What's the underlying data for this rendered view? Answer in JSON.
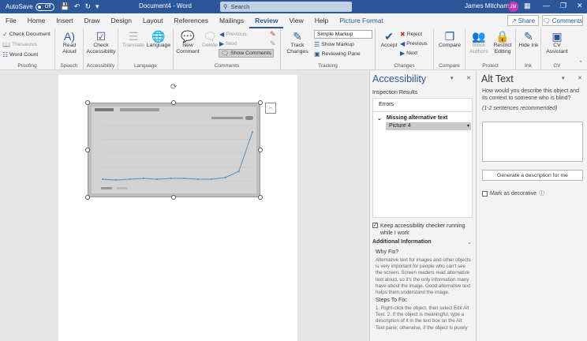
{
  "titlebar": {
    "autosave_label": "AutoSave",
    "autosave_state": "Off",
    "doc_title": "Document4 - Word",
    "search_placeholder": "Search",
    "user_name": "James Mitcham",
    "user_initials": "JM"
  },
  "tabs": [
    "File",
    "Home",
    "Insert",
    "Draw",
    "Design",
    "Layout",
    "References",
    "Mailings",
    "Review",
    "View",
    "Help",
    "Picture Format"
  ],
  "active_tab": "Review",
  "share_label": "Share",
  "comments_label": "Comments",
  "ribbon": {
    "proofing": {
      "label": "Proofing",
      "check_document": "Check Document",
      "thesaurus": "Thesaurus",
      "word_count": "Word Count"
    },
    "speech": {
      "label": "Speech",
      "read_aloud": "Read Aloud"
    },
    "accessibility": {
      "label": "Accessibility",
      "check_accessibility": "Check Accessibility"
    },
    "language": {
      "label": "Language",
      "translate": "Translate",
      "language": "Language"
    },
    "comments": {
      "label": "Comments",
      "new_comment": "New Comment",
      "delete": "Delete",
      "previous": "Previous",
      "next": "Next",
      "show_comments": "Show Comments"
    },
    "tracking": {
      "label": "Tracking",
      "track_changes": "Track Changes",
      "simple_markup": "Simple Markup",
      "show_markup": "Show Markup",
      "reviewing_pane": "Reviewing Pane"
    },
    "changes": {
      "label": "Changes",
      "accept": "Accept",
      "reject": "Reject",
      "previous": "Previous",
      "next": "Next"
    },
    "compare": {
      "label": "Compare",
      "compare": "Compare"
    },
    "protect": {
      "label": "Protect",
      "block_authors": "Block Authors",
      "restrict_editing": "Restrict Editing"
    },
    "ink": {
      "label": "Ink",
      "hide_ink": "Hide Ink"
    },
    "cv": {
      "label": "CV",
      "cv_assistant": "CV Assistant"
    }
  },
  "accessibility_pane": {
    "title": "Accessibility",
    "subtitle": "Inspection Results",
    "errors_heading": "Errors",
    "missing_alt": "Missing alternative text",
    "picture_item": "Picture 4",
    "keep_running": "Keep accessibility checker running while I work",
    "additional_info": "Additional Information",
    "why_fix": "Why Fix?",
    "why_fix_text": "Alternative text for images and other objects is very important for people who can't see the screen. Screen readers read alternative text aloud, so it's the only information many have about the image. Good alternative text helps them understand the image.",
    "steps_heading": "Steps To Fix:",
    "steps_text": "1. Right-click the object, then select Edit Alt Text. 2. If the object is meaningful, type a description of it in the text box on the Alt Text pane; otherwise, if the object is purely"
  },
  "alt_text_pane": {
    "title": "Alt Text",
    "question": "How would you describe this object and its context to someone who is blind?",
    "recommendation": "(1-2 sentences recommended)",
    "generate_button": "Generate a description for me",
    "mark_decorative": "Mark as decorative"
  },
  "chart_data": {
    "type": "line",
    "x": [
      1,
      2,
      3,
      4,
      5,
      6,
      7,
      8,
      9,
      10,
      11,
      12
    ],
    "values": [
      2,
      1,
      2,
      3,
      2,
      3,
      3,
      2,
      2,
      4,
      12,
      62
    ],
    "ylim": [
      0,
      70
    ]
  }
}
